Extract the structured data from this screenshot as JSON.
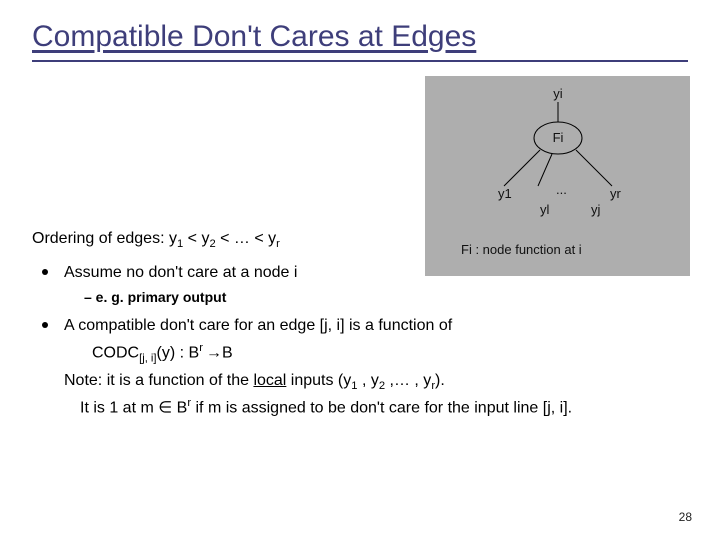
{
  "title": "Compatible Don't Cares at Edges",
  "figure": {
    "yi": "yi",
    "Fi": "Fi",
    "y1": "y1",
    "dots": "...",
    "yr": "yr",
    "yl": "yl",
    "yj": "yj",
    "caption_pre": "Fi",
    "caption_post": " : node function at i"
  },
  "b": {
    "ord_pre": "Ordering of edges: y",
    "ord_mid1": " < y",
    "ord_mid2": " < … < y",
    "sub1": "1",
    "sub2": "2",
    "subr": "r",
    "assume": "Assume no don't care at a node i",
    "eg": "–   e. g. primary output",
    "compat": "A compatible don't care for an edge [j, i] is a function of",
    "codc_pre": "CODC",
    "codc_sub": "[j, i]",
    "codc_y": "(y) : B",
    "codc_sup": "r ",
    "arrow": "→",
    "codc_end": "B",
    "note_pre": "Note: it is a function of the ",
    "local": "local",
    "note_post": " inputs (y",
    "note_s1": "1",
    "comma1": " , y",
    "note_s2": "2",
    "comma2": " ,… , y",
    "note_sr": "r",
    "note_end": ").",
    "it_pre": "It is 1 at m ",
    "elem": "∈",
    "it_mid": " B",
    "it_sup": "r",
    "it_post": " if m is assigned to be don't care for the input line [j, i]."
  },
  "page": "28"
}
